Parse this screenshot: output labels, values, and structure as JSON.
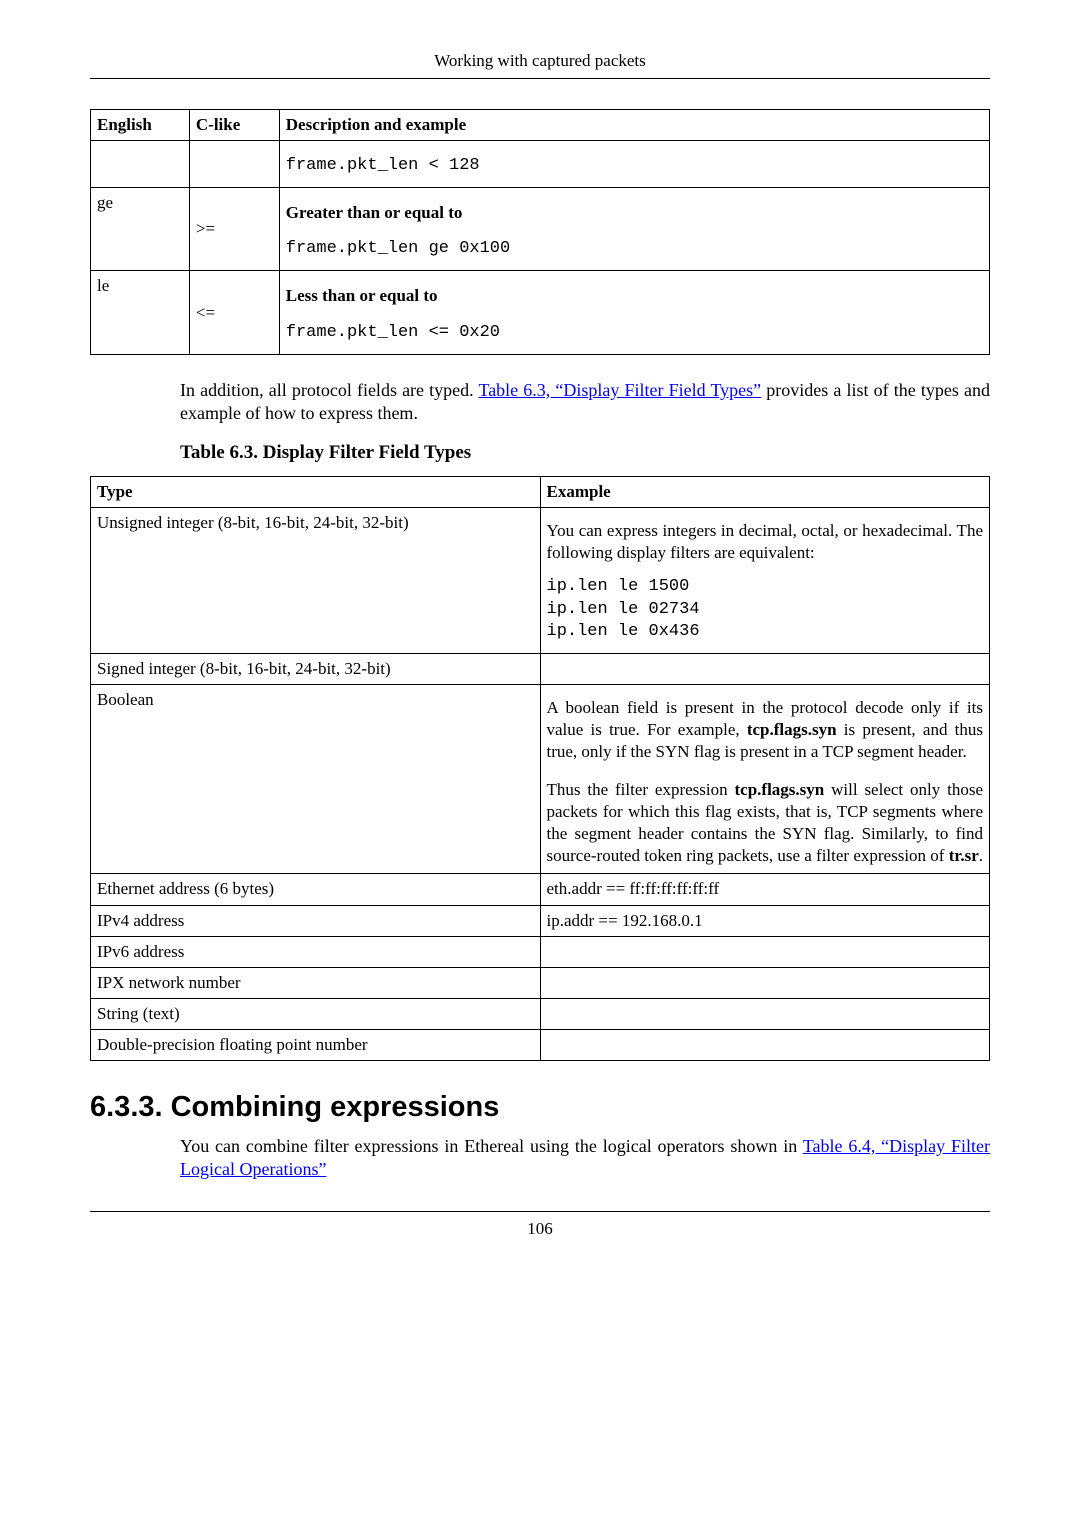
{
  "header": "Working with captured packets",
  "pageno": "106",
  "table1": {
    "headers": {
      "english": "English",
      "clike": "C-like",
      "desc": "Description and example"
    },
    "rows": [
      {
        "english": "",
        "clike": "",
        "code": "frame.pkt_len < 128"
      },
      {
        "english": "ge",
        "clike": ">=",
        "label": "Greater than or equal to",
        "code": "frame.pkt_len ge 0x100"
      },
      {
        "english": "le",
        "clike": "<=",
        "label": "Less than or equal to",
        "code": "frame.pkt_len <= 0x20"
      }
    ]
  },
  "para1": {
    "pre": "In addition, all protocol fields are typed. ",
    "link": "Table 6.3, “Display Filter Field Types”",
    "post": " provides a list of the types and example of how to express them."
  },
  "caption": "Table 6.3. Display Filter Field Types",
  "table2": {
    "headers": {
      "type": "Type",
      "example": "Example"
    },
    "rows": {
      "unsigned": {
        "type": "Unsigned integer (8-bit, 16-bit, 24-bit, 32-bit)",
        "text": "You can express integers in decimal, octal, or hexadecimal. The following display filters are equivalent:",
        "code": "ip.len le 1500\nip.len le 02734\nip.len le 0x436"
      },
      "signed": {
        "type": "Signed integer (8-bit, 16-bit, 24-bit, 32-bit)",
        "example": ""
      },
      "boolean": {
        "type": "Boolean",
        "p1a": "A boolean field is present in the protocol decode only if its value is true. For example, ",
        "p1b": "tcp.flags.syn",
        "p1c": " is present, and thus true, only if the SYN flag is present in a TCP segment header.",
        "p2a": "Thus the filter expression ",
        "p2b": "tcp.flags.syn",
        "p2c": " will select only those packets for which this flag exists, that is, TCP segments where the segment header contains the SYN flag. Similarly, to find source-routed token ring packets, use a filter expression of ",
        "p2d": "tr.sr",
        "p2e": "."
      },
      "ethernet": {
        "type": "Ethernet address (6 bytes)",
        "example": "eth.addr == ff:ff:ff:ff:ff:ff"
      },
      "ipv4": {
        "type": "IPv4 address",
        "example": "ip.addr == 192.168.0.1"
      },
      "ipv6": {
        "type": "IPv6 address",
        "example": ""
      },
      "ipx": {
        "type": "IPX network number",
        "example": ""
      },
      "string": {
        "type": "String (text)",
        "example": ""
      },
      "double": {
        "type": "Double-precision floating point number",
        "example": ""
      }
    }
  },
  "section": {
    "heading": "6.3.3. Combining expressions",
    "pre": "You can combine filter expressions in Ethereal using the logical operators shown in ",
    "link": "Table 6.4, “Display Filter Logical Operations”"
  }
}
